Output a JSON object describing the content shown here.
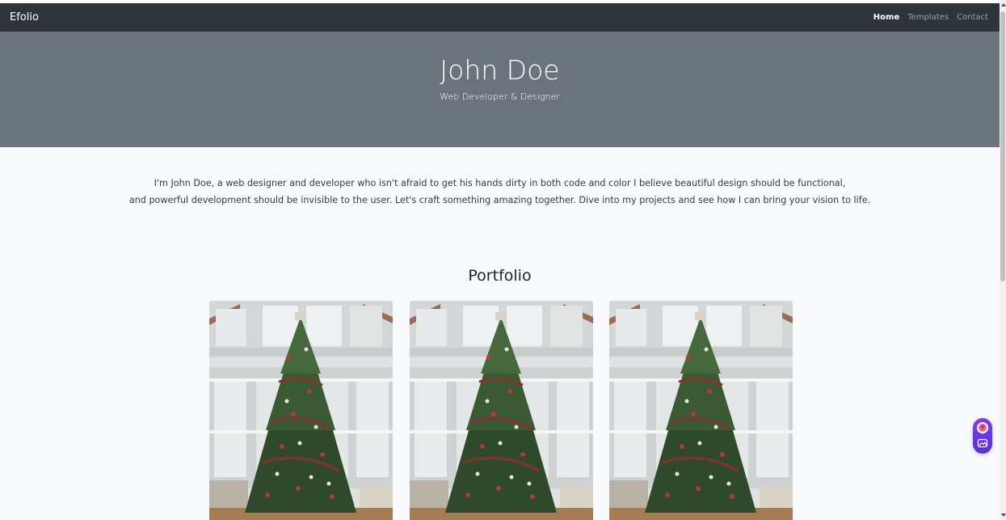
{
  "navbar": {
    "brand": "Efolio",
    "links": [
      {
        "label": "Home",
        "active": true
      },
      {
        "label": "Templates",
        "active": false
      },
      {
        "label": "Contact",
        "active": false
      }
    ]
  },
  "hero": {
    "name": "John Doe",
    "subtitle": "Web Developer & Designer"
  },
  "about": {
    "line1": "I'm John Doe, a web designer and developer who isn't afraid to get his hands dirty in both code and color I believe beautiful design should be functional,",
    "line2": "and powerful development should be invisible to the user. Let's craft something amazing together. Dive into my projects and see how I can bring your vision to life."
  },
  "portfolio": {
    "title": "Portfolio",
    "items": [
      {
        "image": "christmas-tree-photo"
      },
      {
        "image": "christmas-tree-photo"
      },
      {
        "image": "christmas-tree-photo"
      }
    ]
  },
  "colors": {
    "navbar": "#2f343b",
    "hero": "#6b737c",
    "page": "#f8f9fa",
    "widget": "#6a35e2"
  }
}
